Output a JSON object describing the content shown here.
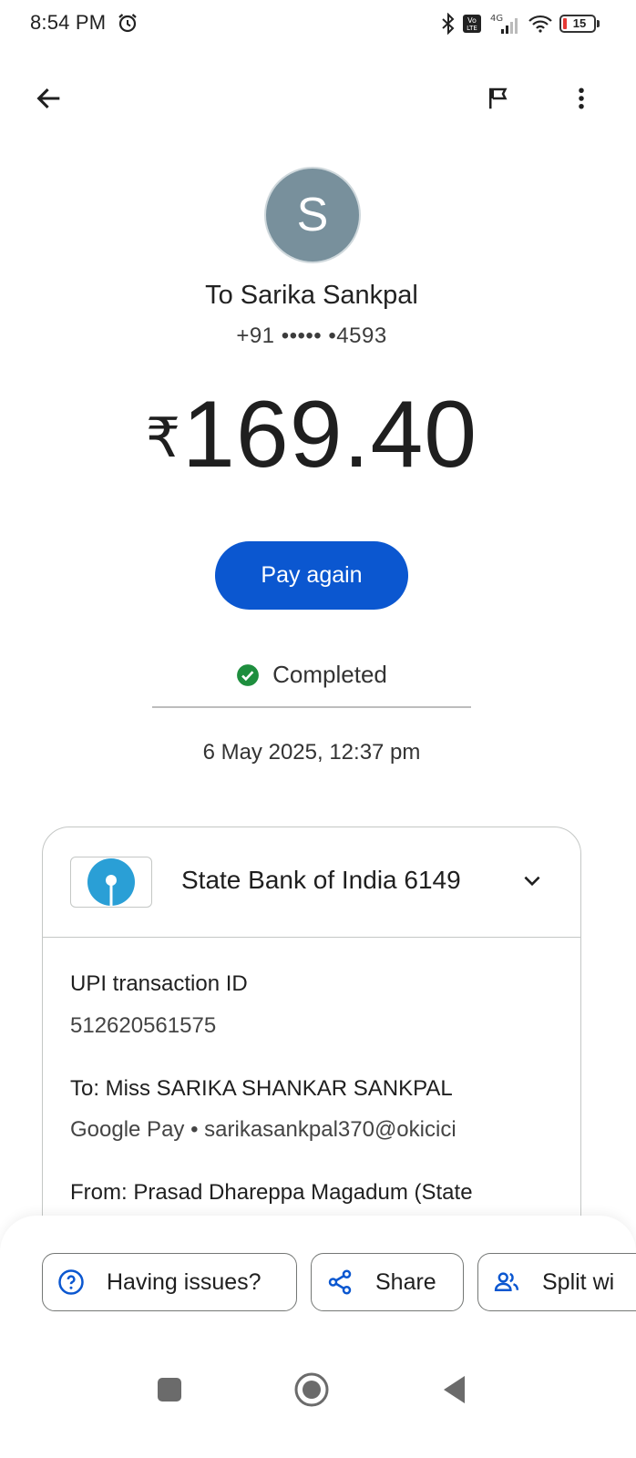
{
  "status_bar": {
    "time": "8:54 PM",
    "network": "4G",
    "volte": "Vo LTE",
    "battery_level": "15"
  },
  "app_bar": {
    "back_icon": "arrow-left-icon",
    "flag_icon": "flag-icon",
    "menu_icon": "more-vertical-icon"
  },
  "recipient": {
    "avatar_letter": "S",
    "name": "To Sarika Sankpal",
    "phone": "+91 ••••• •4593"
  },
  "amount": {
    "currency": "₹",
    "value": "169.40"
  },
  "actions": {
    "pay_again": "Pay again"
  },
  "status": {
    "label": "Completed",
    "color": "#1e8e3e"
  },
  "datetime": "6 May 2025, 12:37 pm",
  "details": {
    "bank_name": "State Bank of India 6149",
    "upi_label": "UPI transaction ID",
    "upi_id": "512620561575",
    "to_label": "To: Miss SARIKA SHANKAR SANKPAL",
    "to_detail": "Google Pay • sarikasankpal370@okicici",
    "from_label": "From: Prasad  Dhareppa Magadum (State"
  },
  "bottom_actions": {
    "issues": "Having issues?",
    "share": "Share",
    "split": "Split wi"
  },
  "colors": {
    "primary": "#0b57d0",
    "avatar_bg": "#78909c",
    "sbi_blue": "#2a9fd6"
  }
}
